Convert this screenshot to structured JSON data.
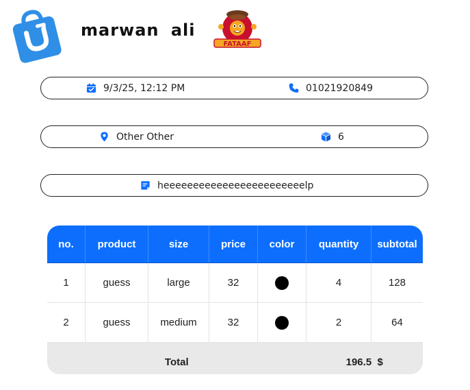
{
  "header": {
    "customer_name": "marwan  ali",
    "app_icon": "shopping-bag-icon",
    "brand_logo": "fataaf-logo"
  },
  "info": {
    "date": "9/3/25, 12:12 PM",
    "phone": "01021920849",
    "location": "Other  Other",
    "items_count": "6",
    "note": "heeeeeeeeeeeeeeeeeeeeeeeelp"
  },
  "icons": {
    "date": "calendar-check-icon",
    "phone": "phone-icon",
    "location": "map-pin-icon",
    "items": "cube-icon",
    "note": "sticky-note-icon"
  },
  "colors": {
    "accent": "#0d6efd",
    "app_icon": "#2f8fe6"
  },
  "table": {
    "headers": [
      "no.",
      "product",
      "size",
      "price",
      "color",
      "quantity",
      "subtotal"
    ],
    "rows": [
      {
        "no": "1",
        "product": "guess",
        "size": "large",
        "price": "32",
        "color": "#000000",
        "quantity": "4",
        "subtotal": "128"
      },
      {
        "no": "2",
        "product": "guess",
        "size": "medium",
        "price": "32",
        "color": "#000000",
        "quantity": "2",
        "subtotal": "64"
      }
    ],
    "total_label": "Total",
    "total_value": "196.5",
    "currency": "$"
  }
}
